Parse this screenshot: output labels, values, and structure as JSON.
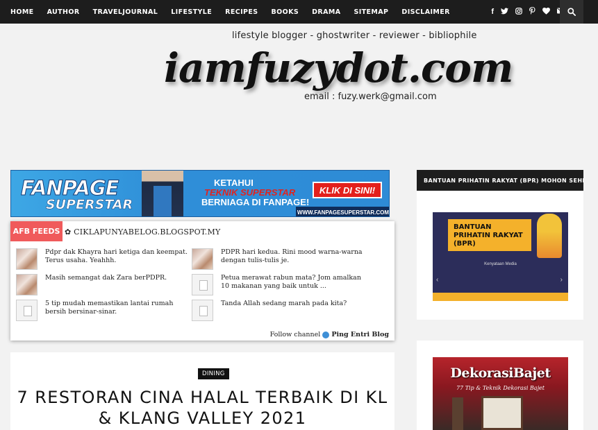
{
  "nav": {
    "items": [
      "HOME",
      "AUTHOR",
      "TRAVELJOURNAL",
      "LIFESTYLE",
      "RECIPES",
      "BOOKS",
      "DRAMA",
      "SITEMAP",
      "DISCLAIMER"
    ],
    "social_icons": [
      "facebook-icon",
      "twitter-icon",
      "instagram-icon",
      "pinterest-icon",
      "heart-icon",
      "mail-icon"
    ],
    "social_glyphs": [
      "f",
      "🐦",
      "◎",
      "℗",
      "♥",
      "✉"
    ],
    "search_icon": "search-icon"
  },
  "header": {
    "tagline": "lifestyle blogger - ghostwriter - reviewer - bibliophile",
    "logo": "iamfuzydot.com",
    "email": "email : fuzy.werk@gmail.com"
  },
  "banner": {
    "line1": "FANPAGE",
    "line2": "SUPERSTAR",
    "text1": "KETAHUI",
    "text2": "TEKNIK SUPERSTAR",
    "text3": "BERNIAGA DI FANPAGE!",
    "button": "KLIK DI SINI!",
    "url": "WWW.FANPAGESUPERSTAR.COM"
  },
  "afb": {
    "tag": "AFB FEEDS",
    "site": "✿ CIKLAPUNYABELOG.BLOGSPOT.MY",
    "items": [
      {
        "text": "Pdpr dak Khayra hari ketiga dan keempat. Terus usaha. Yeahhh.",
        "thumb": "photo"
      },
      {
        "text": "PDPR hari kedua. Rini mood warna-warna dengan tulis-tulis je.",
        "thumb": "photo"
      },
      {
        "text": "Masih semangat dak Zara berPDPR.",
        "thumb": "photo"
      },
      {
        "text": "Petua merawat rabun mata? Jom amalkan 10 makanan yang baik untuk ...",
        "thumb": "placeholder"
      },
      {
        "text": "5 tip mudah memastikan lantai rumah bersih bersinar-sinar.",
        "thumb": "placeholder"
      },
      {
        "text": "Tanda Allah sedang marah pada kita?",
        "thumb": "placeholder"
      }
    ],
    "follow_text": "Follow channel",
    "follow_link": "Ping Entri Blog"
  },
  "post": {
    "category": "DINING",
    "title": "7 RESTORAN CINA HALAL TERBAIK DI KL & KLANG VALLEY 2021"
  },
  "sidebar": {
    "widget1_title": "BANTUAN PRIHATIN RAKYAT (BPR) MOHON SEHINGGA",
    "bpr_title": "BANTUAN PRIHATIN RAKYAT (BPR)",
    "bpr_caption": "Kenyataan Media",
    "widget2_title": "DekorasiBajet",
    "widget2_subtitle": "77 Tip & Teknik Dekorasi Bajet"
  }
}
